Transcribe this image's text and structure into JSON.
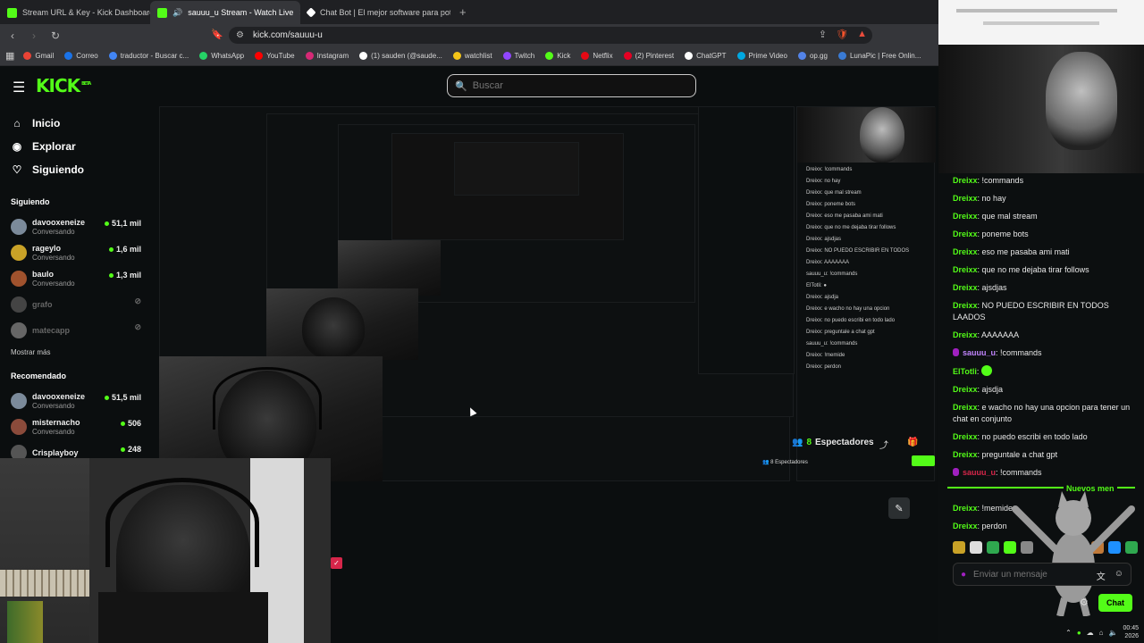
{
  "tabs": [
    {
      "label": "Stream URL & Key - Kick Dashboard",
      "favicon_color": "#53fc18",
      "active": false
    },
    {
      "label": "sauuu_u Stream - Watch Live",
      "favicon_color": "#53fc18",
      "active": true
    },
    {
      "label": "Chat Bot | El mejor software para pot",
      "favicon_color": "#ffffff",
      "active": false
    }
  ],
  "address": {
    "url": "kick.com/sauuu-u"
  },
  "bookmarks": [
    {
      "label": "Gmail",
      "color": "#ea4335"
    },
    {
      "label": "Correo",
      "color": "#1a73e8"
    },
    {
      "label": "traductor - Buscar c...",
      "color": "#4285f4"
    },
    {
      "label": "WhatsApp",
      "color": "#25d366"
    },
    {
      "label": "YouTube",
      "color": "#ff0000"
    },
    {
      "label": "Instagram",
      "color": "#d62976"
    },
    {
      "label": "(1) sauden (@saude...",
      "color": "#ffffff"
    },
    {
      "label": "watchlist",
      "color": "#f5c518"
    },
    {
      "label": "Twitch",
      "color": "#9146ff"
    },
    {
      "label": "Kick",
      "color": "#53fc18"
    },
    {
      "label": "Netflix",
      "color": "#e50914"
    },
    {
      "label": "(2) Pinterest",
      "color": "#e60023"
    },
    {
      "label": "ChatGPT",
      "color": "#ffffff"
    },
    {
      "label": "Prime Video",
      "color": "#00a8e1"
    },
    {
      "label": "op.gg",
      "color": "#5383e8"
    },
    {
      "label": "LunaPic | Free Onlin...",
      "color": "#3a7bd5"
    }
  ],
  "kick": {
    "logo": "KICK",
    "logo_beta": "BETA",
    "search_placeholder": "Buscar",
    "nav": [
      {
        "label": "Inicio",
        "icon": "home-icon"
      },
      {
        "label": "Explorar",
        "icon": "compass-icon"
      },
      {
        "label": "Siguiendo",
        "icon": "heart-icon"
      }
    ],
    "following_title": "Siguiendo",
    "following": [
      {
        "name": "davooxeneize",
        "sub": "Conversando",
        "viewers": "51,1 mil",
        "color": "#7b8a9a"
      },
      {
        "name": "rageylo",
        "sub": "Conversando",
        "viewers": "1,6 mil",
        "color": "#c9a227"
      },
      {
        "name": "baulo",
        "sub": "Conversando",
        "viewers": "1,3 mil",
        "color": "#a0522d"
      },
      {
        "name": "grafo",
        "sub": "",
        "viewers": "",
        "color": "#444444"
      },
      {
        "name": "matecapp",
        "sub": "",
        "viewers": "",
        "color": "#666666"
      }
    ],
    "show_more": "Mostrar más",
    "recommended_title": "Recomendado",
    "recommended": [
      {
        "name": "davooxeneize",
        "sub": "Conversando",
        "viewers": "51,5 mil",
        "color": "#7b8a9a"
      },
      {
        "name": "misternacho",
        "sub": "Conversando",
        "viewers": "506",
        "color": "#8b4b3b"
      },
      {
        "name": "Crisplayboy",
        "sub": "",
        "viewers": "248",
        "color": "#555555"
      }
    ],
    "viewers_count": "8",
    "viewers_label": "Espectadores"
  },
  "chat": {
    "messages": [
      {
        "user": "Dreixx",
        "color": "#53fc18",
        "text": "!commands"
      },
      {
        "user": "Dreixx",
        "color": "#53fc18",
        "text": "no hay"
      },
      {
        "user": "Dreixx",
        "color": "#53fc18",
        "text": "que mal stream"
      },
      {
        "user": "Dreixx",
        "color": "#53fc18",
        "text": "poneme bots"
      },
      {
        "user": "Dreixx",
        "color": "#53fc18",
        "text": "eso me pasaba ami mati"
      },
      {
        "user": "Dreixx",
        "color": "#53fc18",
        "text": "que no me dejaba tirar follows"
      },
      {
        "user": "Dreixx",
        "color": "#53fc18",
        "text": "ajsdjas"
      },
      {
        "user": "Dreixx",
        "color": "#53fc18",
        "text": "NO PUEDO ESCRIBIR EN TODOS LAADOS"
      },
      {
        "user": "Dreixx",
        "color": "#53fc18",
        "text": "AAAAAAA"
      },
      {
        "user": "sauuu_u",
        "color": "#c084fc",
        "text": "!commands",
        "badge": true
      },
      {
        "user": "ElTotli",
        "color": "#53fc18",
        "text": "",
        "emote": true
      },
      {
        "user": "Dreixx",
        "color": "#53fc18",
        "text": "ajsdja"
      },
      {
        "user": "Dreixx",
        "color": "#53fc18",
        "text": "e wacho no hay una opcion para tener un chat en conjunto"
      },
      {
        "user": "Dreixx",
        "color": "#53fc18",
        "text": "no puedo escribi en todo lado"
      },
      {
        "user": "Dreixx",
        "color": "#53fc18",
        "text": "preguntale a chat gpt"
      },
      {
        "user": "sauuu_u",
        "color": "#d6264a",
        "text": "!commands",
        "badge": true
      }
    ],
    "new_messages_label": "Nuevos men",
    "after_messages": [
      {
        "user": "Dreixx",
        "color": "#53fc18",
        "text": "!memide"
      },
      {
        "user": "Dreixx",
        "color": "#53fc18",
        "text": "perdon"
      }
    ],
    "input_placeholder": "Enviar un mensaje",
    "chat_button": "Chat"
  },
  "tray": {
    "time": "00:45",
    "date": "2026"
  }
}
